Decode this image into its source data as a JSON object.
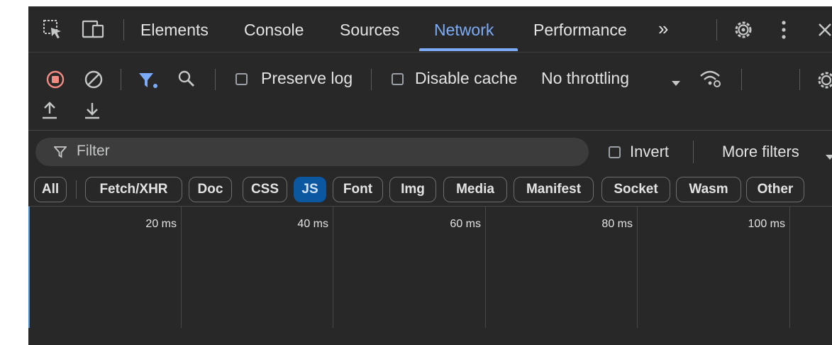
{
  "tabs": [
    {
      "label": "Elements",
      "active": false
    },
    {
      "label": "Console",
      "active": false
    },
    {
      "label": "Sources",
      "active": false
    },
    {
      "label": "Network",
      "active": true
    },
    {
      "label": "Performance",
      "active": false
    }
  ],
  "tab_icons": [
    "inspect-element-icon",
    "device-toolbar-icon",
    "more-tabs-icon",
    "settings-icon",
    "kebab-menu-icon",
    "close-icon"
  ],
  "tab_overflow_glyph": "»",
  "toolbar": {
    "preserve_log_label": "Preserve log",
    "preserve_log_checked": false,
    "disable_cache_label": "Disable cache",
    "disable_cache_checked": false,
    "throttling_value": "No throttling"
  },
  "filter": {
    "placeholder": "Filter",
    "invert_label": "Invert",
    "invert_checked": false,
    "more_filters_label": "More filters"
  },
  "resource_types": [
    {
      "label": "All",
      "active": false
    },
    {
      "label": "Fetch/XHR",
      "active": false
    },
    {
      "label": "Doc",
      "active": false
    },
    {
      "label": "CSS",
      "active": false
    },
    {
      "label": "JS",
      "active": true
    },
    {
      "label": "Font",
      "active": false
    },
    {
      "label": "Img",
      "active": false
    },
    {
      "label": "Media",
      "active": false
    },
    {
      "label": "Manifest",
      "active": false
    },
    {
      "label": "Socket",
      "active": false
    },
    {
      "label": "Wasm",
      "active": false
    },
    {
      "label": "Other",
      "active": false
    }
  ],
  "timeline": {
    "ticks": [
      "20 ms",
      "40 ms",
      "60 ms",
      "80 ms",
      "100 ms"
    ]
  },
  "colors": {
    "accent": "#7cacf8",
    "record_stop": "#f28b82",
    "active_chip": "#0b57a0",
    "panel_bg": "#282828"
  }
}
